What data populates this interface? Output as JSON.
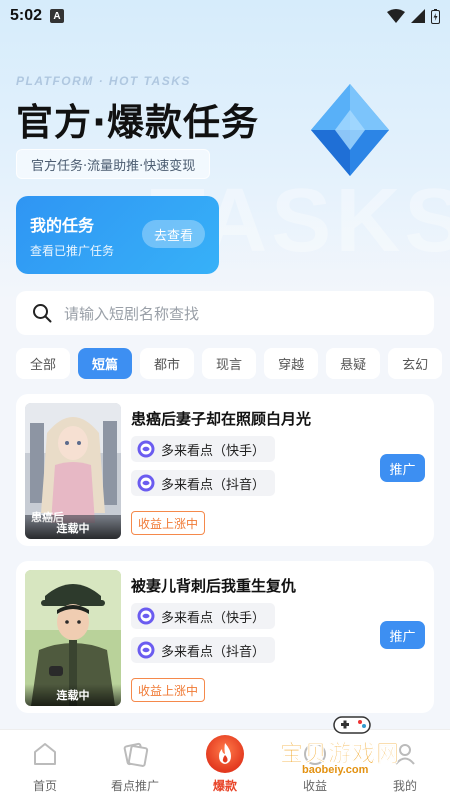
{
  "status": {
    "time": "5:02",
    "notification": "A"
  },
  "hero": {
    "tagline": "PLATFORM · HOT TASKS",
    "title": "官方·爆款任务",
    "subtitle": "官方任务·流量助推·快速变现",
    "watermark": "TASKS"
  },
  "my_task": {
    "title": "我的任务",
    "subtitle": "查看已推广任务",
    "button": "去查看"
  },
  "search": {
    "placeholder": "请输入短剧名称查找"
  },
  "categories": [
    "全部",
    "短篇",
    "都市",
    "现言",
    "穿越",
    "悬疑",
    "玄幻"
  ],
  "active_category": "短篇",
  "cards": [
    {
      "title": "患癌后妻子却在照顾白月光",
      "platforms": [
        "多来看点（快手）",
        "多来看点（抖音）"
      ],
      "earn": "收益上涨中",
      "badge": "连载中",
      "cover_text": "患癌后",
      "button": "推广"
    },
    {
      "title": "被妻儿背刺后我重生复仇",
      "platforms": [
        "多来看点（快手）",
        "多来看点（抖音）"
      ],
      "earn": "收益上涨中",
      "badge": "连载中",
      "button": "推广"
    }
  ],
  "tabs": [
    "首页",
    "看点推广",
    "爆款",
    "收益",
    "我的"
  ],
  "active_tab": "爆款",
  "site_watermark": {
    "name": "宝贝游戏网",
    "url": "baobeiy.com"
  },
  "colors": {
    "accent": "#3d8ff2",
    "earn": "#f07a35",
    "fire": "#e3391f"
  }
}
